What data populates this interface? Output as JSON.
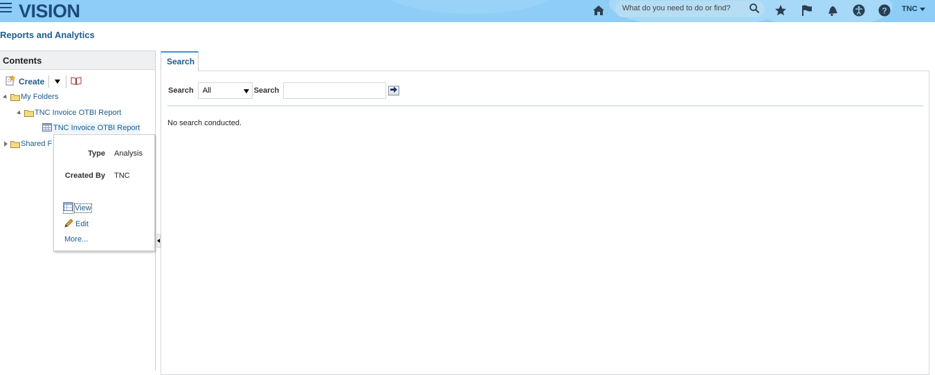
{
  "header": {
    "logo": "VISION",
    "search_placeholder": "What do you need to do or find?",
    "user": "TNC",
    "icons": [
      "home-icon",
      "search-icon",
      "favorites-star-icon",
      "notifications-flag-icon",
      "bell-icon",
      "accessibility-icon",
      "help-icon"
    ]
  },
  "page": {
    "title": "Reports and Analytics"
  },
  "contents": {
    "header": "Contents",
    "toolbar": {
      "create_label": "Create"
    },
    "tree": [
      {
        "label": "My Folders",
        "expanded": true
      },
      {
        "label": "TNC Invoice OTBI Report",
        "expanded": true
      },
      {
        "label": "TNC Invoice OTBI Report",
        "type": "analysis"
      },
      {
        "label": "Shared F",
        "expanded": false
      }
    ]
  },
  "popup": {
    "type_label": "Type",
    "type_value": "Analysis",
    "created_by_label": "Created By",
    "created_by_value": "TNC",
    "actions": {
      "view": "View",
      "edit": "Edit",
      "more": "More..."
    }
  },
  "search_panel": {
    "tab_label": "Search",
    "search_label": "Search",
    "select_value": "All",
    "search_field_label": "Search",
    "input_value": "",
    "status": "No search conducted."
  },
  "colors": {
    "topbar": "#8ecdf5",
    "link": "#1a5c8c",
    "logo": "#1d4a7a"
  }
}
